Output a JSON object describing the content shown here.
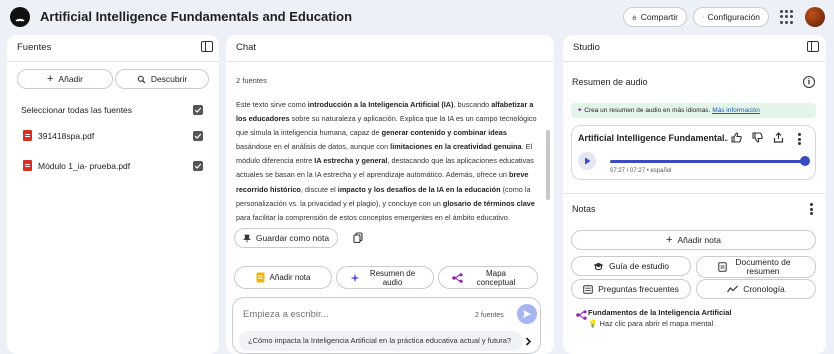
{
  "header": {
    "title": "Artificial Intelligence Fundamentals and Education",
    "share_label": "Compartir",
    "settings_label": "Configuración"
  },
  "sources": {
    "title": "Fuentes",
    "add_label": "Añadir",
    "discover_label": "Descubrir",
    "select_all_label": "Seleccionar todas las fuentes",
    "items": [
      {
        "name": "391418spa.pdf",
        "checked": true
      },
      {
        "name": "Módulo 1_ia- prueba.pdf",
        "checked": true
      }
    ]
  },
  "chat": {
    "title": "Chat",
    "source_count": "2 fuentes",
    "summary_html": "Este texto sirve como <b>introducción a la Inteligencia Artificial (IA)</b>, buscando <b>alfabetizar a los educadores</b> sobre su naturaleza y aplicación. Explica que la IA es un campo tecnológico que simula la inteligencia humana, capaz de <b>generar contenido y combinar ideas</b> basándose en el análisis de datos, aunque con <b>limitaciones en la creatividad genuina</b>. El módulo diferencia entre <b>IA estrecha y general</b>, destacando que las aplicaciones educativas actuales se basan en la IA estrecha y el aprendizaje automático. Además, ofrece un <b>breve recorrido histórico</b>, discute el <b>impacto y los desafíos de la IA en la educación</b> (como la personalización vs. la privacidad y el plagio), y concluye con un <b>glosario de términos clave</b> para facilitar la comprensión de estos conceptos emergentes en el ámbito educativo.",
    "save_note_label": "Guardar como nota",
    "actions": [
      {
        "label": "Añadir nota"
      },
      {
        "label": "Resumen de audio"
      },
      {
        "label": "Mapa conceptual"
      }
    ],
    "composer": {
      "placeholder": "Empieza a escribir...",
      "source_count": "2 fuentes",
      "suggestion": "¿Cómo impacta la Inteligencia Artificial en la práctica educativa actual y futura?"
    }
  },
  "studio": {
    "title": "Studio",
    "audio_overview": {
      "heading": "Resumen de audio",
      "banner_text": "Crea un resumen de audio en más idiomas.",
      "banner_link": "Más información",
      "card_title": "Artificial Intelligence Fundamental...",
      "time": "07:27 / 07:27 • español",
      "progress": 1.0
    },
    "notes": {
      "heading": "Notas",
      "add_note_label": "Añadir nota",
      "buttons": [
        {
          "label": "Guía de estudio"
        },
        {
          "label": "Documento de resumen"
        },
        {
          "label": "Preguntas frecuentes"
        },
        {
          "label": "Cronología"
        }
      ],
      "items": [
        {
          "title": "Fundamentos de la Inteligencia Artificial",
          "subtitle": "Haz clic para abrir el mapa mental"
        }
      ]
    }
  },
  "colors": {
    "background": "#eef0f8",
    "accent": "#3a4bc2",
    "pdf_red": "#d93025",
    "banner_green": "#e3f5e8"
  }
}
